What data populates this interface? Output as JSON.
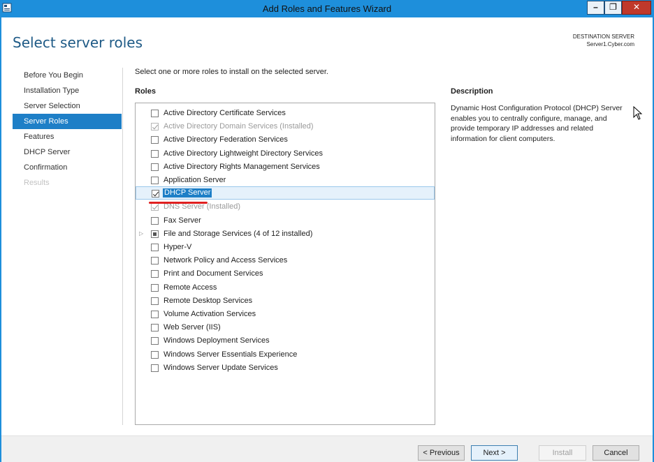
{
  "window": {
    "title": "Add Roles and Features Wizard"
  },
  "page": {
    "title": "Select server roles"
  },
  "destination": {
    "label": "DESTINATION SERVER",
    "server": "Server1.Cyber.com"
  },
  "nav": {
    "items": [
      {
        "label": "Before You Begin",
        "state": "normal"
      },
      {
        "label": "Installation Type",
        "state": "normal"
      },
      {
        "label": "Server Selection",
        "state": "normal"
      },
      {
        "label": "Server Roles",
        "state": "active"
      },
      {
        "label": "Features",
        "state": "normal"
      },
      {
        "label": "DHCP Server",
        "state": "normal"
      },
      {
        "label": "Confirmation",
        "state": "normal"
      },
      {
        "label": "Results",
        "state": "disabled"
      }
    ]
  },
  "main": {
    "instruction": "Select one or more roles to install on the selected server.",
    "roles_header": "Roles",
    "roles": [
      {
        "label": "Active Directory Certificate Services",
        "checked": false,
        "disabled": false
      },
      {
        "label": "Active Directory Domain Services (Installed)",
        "checked": true,
        "disabled": true
      },
      {
        "label": "Active Directory Federation Services",
        "checked": false,
        "disabled": false
      },
      {
        "label": "Active Directory Lightweight Directory Services",
        "checked": false,
        "disabled": false
      },
      {
        "label": "Active Directory Rights Management Services",
        "checked": false,
        "disabled": false
      },
      {
        "label": "Application Server",
        "checked": false,
        "disabled": false
      },
      {
        "label": "DHCP Server",
        "checked": true,
        "disabled": false,
        "selected": true
      },
      {
        "label": "DNS Server (Installed)",
        "checked": true,
        "disabled": true
      },
      {
        "label": "Fax Server",
        "checked": false,
        "disabled": false
      },
      {
        "label": "File and Storage Services (4 of 12 installed)",
        "checked": "partial",
        "disabled": false,
        "expandable": true
      },
      {
        "label": "Hyper-V",
        "checked": false,
        "disabled": false
      },
      {
        "label": "Network Policy and Access Services",
        "checked": false,
        "disabled": false
      },
      {
        "label": "Print and Document Services",
        "checked": false,
        "disabled": false
      },
      {
        "label": "Remote Access",
        "checked": false,
        "disabled": false
      },
      {
        "label": "Remote Desktop Services",
        "checked": false,
        "disabled": false
      },
      {
        "label": "Volume Activation Services",
        "checked": false,
        "disabled": false
      },
      {
        "label": "Web Server (IIS)",
        "checked": false,
        "disabled": false
      },
      {
        "label": "Windows Deployment Services",
        "checked": false,
        "disabled": false
      },
      {
        "label": "Windows Server Essentials Experience",
        "checked": false,
        "disabled": false
      },
      {
        "label": "Windows Server Update Services",
        "checked": false,
        "disabled": false
      }
    ],
    "expander_glyph": "▷"
  },
  "description": {
    "header": "Description",
    "text": "Dynamic Host Configuration Protocol (DHCP) Server enables you to centrally configure, manage, and provide temporary IP addresses and related information for client computers."
  },
  "buttons": {
    "previous": "< Previous",
    "next": "Next >",
    "install": "Install",
    "cancel": "Cancel"
  },
  "window_controls": {
    "minimize": "–",
    "restore": "❐",
    "close": "✕"
  },
  "colors": {
    "accent": "#1e7fc7",
    "titlebar": "#1e8fdb",
    "annotation": "#e02020"
  }
}
